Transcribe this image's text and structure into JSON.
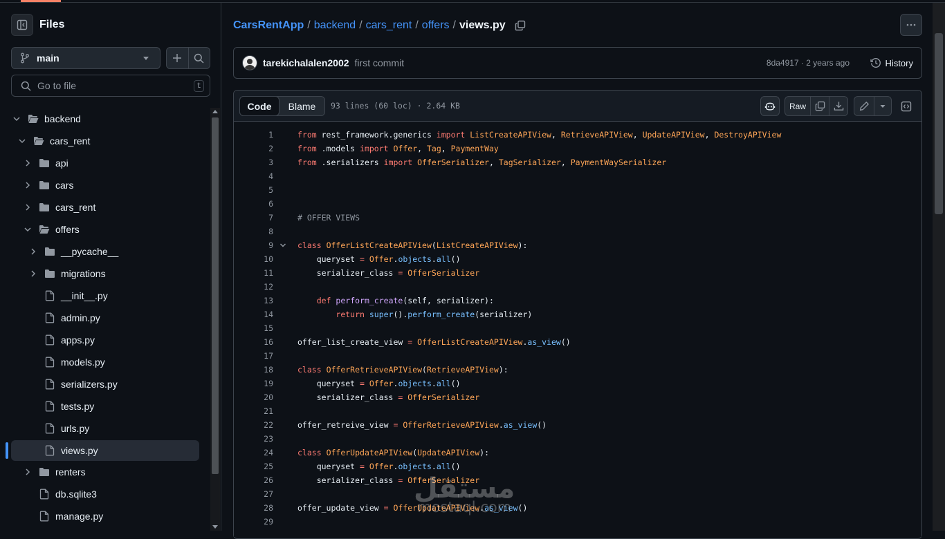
{
  "sidebar": {
    "title": "Files",
    "branch": "main",
    "search_placeholder": "Go to file",
    "search_shortcut": "t",
    "tree": [
      {
        "label": "backend",
        "type": "folder",
        "depth": 0,
        "expanded": true
      },
      {
        "label": "cars_rent",
        "type": "folder",
        "depth": 1,
        "expanded": true
      },
      {
        "label": "api",
        "type": "folder",
        "depth": 2,
        "expanded": false
      },
      {
        "label": "cars",
        "type": "folder",
        "depth": 2,
        "expanded": false
      },
      {
        "label": "cars_rent",
        "type": "folder",
        "depth": 2,
        "expanded": false
      },
      {
        "label": "offers",
        "type": "folder",
        "depth": 2,
        "expanded": true
      },
      {
        "label": "__pycache__",
        "type": "folder",
        "depth": 3,
        "expanded": false
      },
      {
        "label": "migrations",
        "type": "folder",
        "depth": 3,
        "expanded": false
      },
      {
        "label": "__init__.py",
        "type": "file",
        "depth": 3
      },
      {
        "label": "admin.py",
        "type": "file",
        "depth": 3
      },
      {
        "label": "apps.py",
        "type": "file",
        "depth": 3
      },
      {
        "label": "models.py",
        "type": "file",
        "depth": 3
      },
      {
        "label": "serializers.py",
        "type": "file",
        "depth": 3
      },
      {
        "label": "tests.py",
        "type": "file",
        "depth": 3
      },
      {
        "label": "urls.py",
        "type": "file",
        "depth": 3
      },
      {
        "label": "views.py",
        "type": "file",
        "depth": 3,
        "selected": true
      },
      {
        "label": "renters",
        "type": "folder",
        "depth": 2,
        "expanded": false
      },
      {
        "label": "db.sqlite3",
        "type": "file",
        "depth": 2
      },
      {
        "label": "manage.py",
        "type": "file",
        "depth": 2
      }
    ]
  },
  "breadcrumb": {
    "repo": "CarsRentApp",
    "parts": [
      "backend",
      "cars_rent",
      "offers"
    ],
    "current": "views.py"
  },
  "commit": {
    "author": "tarekichalalen2002",
    "message": "first commit",
    "meta": "8da4917 · 2 years ago",
    "history_label": "History"
  },
  "file": {
    "tab_code": "Code",
    "tab_blame": "Blame",
    "info": "93 lines (60 loc) · 2.64 KB",
    "raw_label": "Raw"
  },
  "code_lines": [
    {
      "n": "1",
      "html": "<span class=\"kw\">from</span> rest_framework.generics <span class=\"kw\">import</span> <span class=\"cls\">ListCreateAPIView</span>, <span class=\"cls\">RetrieveAPIView</span>, <span class=\"cls\">UpdateAPIView</span>, <span class=\"cls\">DestroyAPIView</span>"
    },
    {
      "n": "2",
      "html": "<span class=\"kw\">from</span> .models <span class=\"kw\">import</span> <span class=\"cls\">Offer</span>, <span class=\"cls\">Tag</span>, <span class=\"cls\">PaymentWay</span>"
    },
    {
      "n": "3",
      "html": "<span class=\"kw\">from</span> .serializers <span class=\"kw\">import</span> <span class=\"cls\">OfferSerializer</span>, <span class=\"cls\">TagSerializer</span>, <span class=\"cls\">PaymentWaySerializer</span>"
    },
    {
      "n": "4",
      "html": ""
    },
    {
      "n": "5",
      "html": ""
    },
    {
      "n": "6",
      "html": ""
    },
    {
      "n": "7",
      "html": "<span class=\"cm\"># OFFER VIEWS</span>"
    },
    {
      "n": "8",
      "html": ""
    },
    {
      "n": "9",
      "fold": true,
      "html": "<span class=\"kw\">class</span> <span class=\"cls\">OfferListCreateAPIView</span>(<span class=\"cls\">ListCreateAPIView</span>):"
    },
    {
      "n": "10",
      "html": "    queryset <span class=\"kw\">=</span> <span class=\"cls\">Offer</span>.<span class=\"attr\">objects</span>.<span class=\"attr\">all</span>()"
    },
    {
      "n": "11",
      "html": "    serializer_class <span class=\"kw\">=</span> <span class=\"cls\">OfferSerializer</span>"
    },
    {
      "n": "12",
      "html": ""
    },
    {
      "n": "13",
      "html": "    <span class=\"kw\">def</span> <span class=\"fn\">perform_create</span>(self, serializer):"
    },
    {
      "n": "14",
      "html": "        <span class=\"kw\">return</span> <span class=\"attr\">super</span>().<span class=\"attr\">perform_create</span>(serializer)"
    },
    {
      "n": "15",
      "html": ""
    },
    {
      "n": "16",
      "html": "offer_list_create_view <span class=\"kw\">=</span> <span class=\"cls\">OfferListCreateAPIView</span>.<span class=\"attr\">as_view</span>()"
    },
    {
      "n": "17",
      "html": ""
    },
    {
      "n": "18",
      "html": "<span class=\"kw\">class</span> <span class=\"cls\">OfferRetrieveAPIView</span>(<span class=\"cls\">RetrieveAPIView</span>):"
    },
    {
      "n": "19",
      "html": "    queryset <span class=\"kw\">=</span> <span class=\"cls\">Offer</span>.<span class=\"attr\">objects</span>.<span class=\"attr\">all</span>()"
    },
    {
      "n": "20",
      "html": "    serializer_class <span class=\"kw\">=</span> <span class=\"cls\">OfferSerializer</span>"
    },
    {
      "n": "21",
      "html": ""
    },
    {
      "n": "22",
      "html": "offer_retreive_view <span class=\"kw\">=</span> <span class=\"cls\">OfferRetrieveAPIView</span>.<span class=\"attr\">as_view</span>()"
    },
    {
      "n": "23",
      "html": ""
    },
    {
      "n": "24",
      "html": "<span class=\"kw\">class</span> <span class=\"cls\">OfferUpdateAPIView</span>(<span class=\"cls\">UpdateAPIView</span>):"
    },
    {
      "n": "25",
      "html": "    queryset <span class=\"kw\">=</span> <span class=\"cls\">Offer</span>.<span class=\"attr\">objects</span>.<span class=\"attr\">all</span>()"
    },
    {
      "n": "26",
      "html": "    serializer_class <span class=\"kw\">=</span> <span class=\"cls\">OfferSerializer</span>"
    },
    {
      "n": "27",
      "html": ""
    },
    {
      "n": "28",
      "html": "offer_update_view <span class=\"kw\">=</span> <span class=\"cls\">OfferUpdateAPIView</span>.<span class=\"attr\">as_view</span>()"
    },
    {
      "n": "29",
      "html": ""
    }
  ],
  "watermark": {
    "arabic": "مستقل",
    "latin": "mostaql.com"
  }
}
